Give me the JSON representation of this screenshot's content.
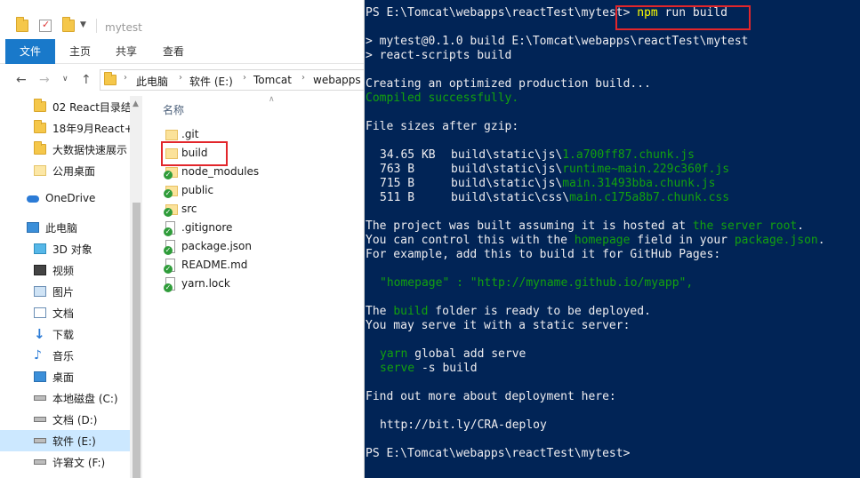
{
  "explorer": {
    "quick_title": "mytest",
    "ribbon_tabs": [
      "文件",
      "主页",
      "共享",
      "查看"
    ],
    "breadcrumb": [
      "此电脑",
      "软件 (E:)",
      "Tomcat",
      "webapps"
    ],
    "nav_items": [
      {
        "label": "02 React目录结",
        "icon": "folder-icon"
      },
      {
        "label": "18年9月React+",
        "icon": "folder-icon"
      },
      {
        "label": "大数据快速展示",
        "icon": "folder-icon"
      },
      {
        "label": "公用桌面",
        "icon": "folder-icon"
      },
      {
        "label": "OneDrive",
        "icon": "cloud-icon"
      },
      {
        "label": "此电脑",
        "icon": "computer-icon"
      },
      {
        "label": "3D 对象",
        "icon": "cube-icon"
      },
      {
        "label": "视频",
        "icon": "video-icon"
      },
      {
        "label": "图片",
        "icon": "picture-icon"
      },
      {
        "label": "文档",
        "icon": "document-icon"
      },
      {
        "label": "下载",
        "icon": "download-icon"
      },
      {
        "label": "音乐",
        "icon": "music-icon"
      },
      {
        "label": "桌面",
        "icon": "desktop-icon"
      },
      {
        "label": "本地磁盘 (C:)",
        "icon": "drive-icon"
      },
      {
        "label": "文档 (D:)",
        "icon": "drive-icon"
      },
      {
        "label": "软件 (E:)",
        "icon": "drive-icon"
      },
      {
        "label": "许窘文 (F:)",
        "icon": "drive-icon"
      }
    ],
    "column_header": "名称",
    "files": [
      {
        "name": ".git",
        "icon": "folder-icon",
        "synced": false
      },
      {
        "name": "build",
        "icon": "folder-icon",
        "synced": false
      },
      {
        "name": "node_modules",
        "icon": "folder-icon",
        "synced": true
      },
      {
        "name": "public",
        "icon": "folder-icon",
        "synced": true
      },
      {
        "name": "src",
        "icon": "folder-icon",
        "synced": true
      },
      {
        "name": ".gitignore",
        "icon": "file-icon",
        "synced": true
      },
      {
        "name": "package.json",
        "icon": "file-icon",
        "synced": true
      },
      {
        "name": "README.md",
        "icon": "file-icon",
        "synced": true
      },
      {
        "name": "yarn.lock",
        "icon": "file-icon",
        "synced": true
      }
    ]
  },
  "terminal": {
    "prompt1": "PS E:\\Tomcat\\webapps\\reactTest\\mytest>",
    "cmd_npm": "npm",
    "cmd_rest": " run build",
    "line_script1": "> mytest@0.1.0 build E:\\Tomcat\\webapps\\reactTest\\mytest",
    "line_script2": "> react-scripts build",
    "creating": "Creating an optimized production build...",
    "compiled": "Compiled successfully.",
    "file_sizes": "File sizes after gzip:",
    "sizes": [
      {
        "size": "34.65 KB",
        "dir": "build\\static\\js\\",
        "file": "1.a700ff87.chunk.js"
      },
      {
        "size": "763 B",
        "dir": "build\\static\\js\\",
        "file": "runtime~main.229c360f.js"
      },
      {
        "size": "715 B",
        "dir": "build\\static\\js\\",
        "file": "main.31493bba.chunk.js"
      },
      {
        "size": "511 B",
        "dir": "build\\static\\css\\",
        "file": "main.c175a8b7.chunk.css"
      }
    ],
    "hosted_a": "The project was built assuming it is hosted at ",
    "hosted_b": "the server root",
    "hosted_c": ".",
    "control_a": "You can control this with the ",
    "control_b": "homepage",
    "control_c": " field in your ",
    "control_d": "package.json",
    "control_e": ".",
    "example": "For example, add this to build it for GitHub Pages:",
    "homepage_line": "\"homepage\" : \"http://myname.github.io/myapp\",",
    "folder_a": "The ",
    "folder_b": "build",
    "folder_c": " folder is ready to be deployed.",
    "serve_line": "You may serve it with a static server:",
    "yarn_a": "yarn",
    "yarn_b": " global add serve",
    "serve_a": "serve",
    "serve_b": " -s build",
    "findout": "Find out more about deployment here:",
    "url": "http://bit.ly/CRA-deploy",
    "prompt2": "PS E:\\Tomcat\\webapps\\reactTest\\mytest>"
  }
}
